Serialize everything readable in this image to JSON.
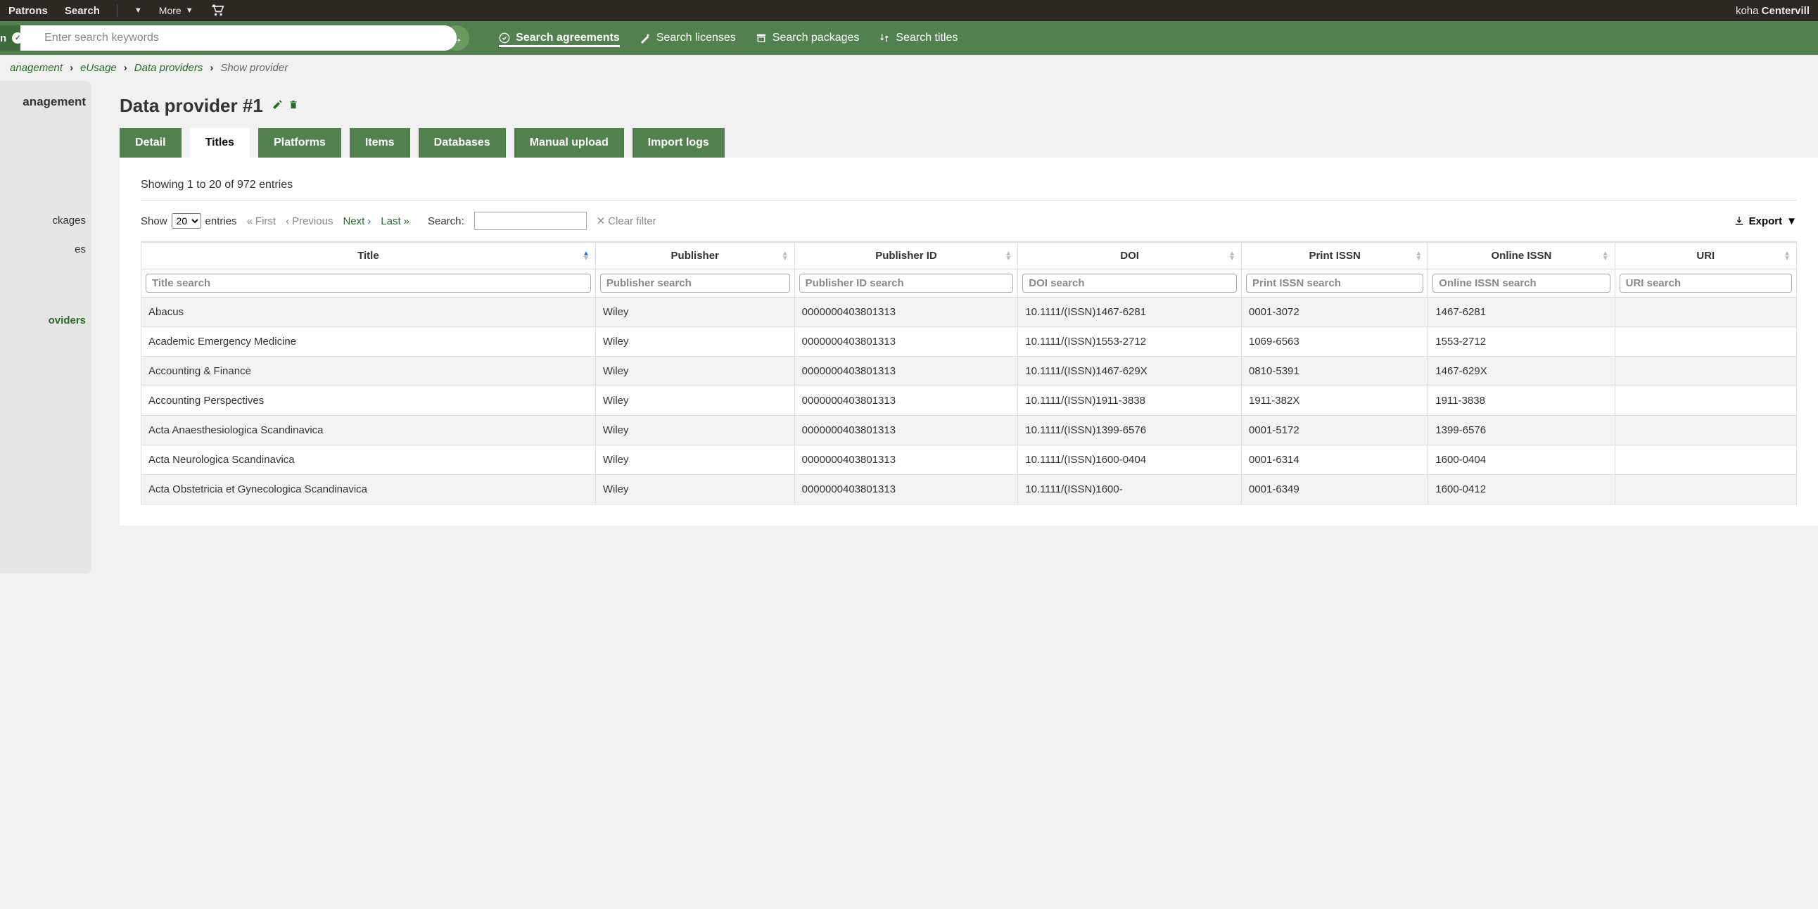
{
  "topbar": {
    "patrons": "Patrons",
    "search": "Search",
    "more": "More",
    "brand": "koha",
    "site": "Centervill"
  },
  "greenbar": {
    "pill_left": "n",
    "placeholder": "Enter search keywords",
    "links": {
      "agreements": "Search agreements",
      "licenses": "Search licenses",
      "packages": "Search packages",
      "titles": "Search titles"
    }
  },
  "breadcrumb": {
    "items": [
      "anagement",
      "eUsage",
      "Data providers",
      "Show provider"
    ]
  },
  "sidebar": {
    "heading": "anagement",
    "items": [
      "ckages",
      "es",
      "oviders"
    ]
  },
  "page": {
    "title": "Data provider #1"
  },
  "tabs": [
    "Detail",
    "Titles",
    "Platforms",
    "Items",
    "Databases",
    "Manual upload",
    "Import logs"
  ],
  "table_info": "Showing 1 to 20 of 972 entries",
  "controls": {
    "show": "Show",
    "entries": "entries",
    "entries_value": "20",
    "first": "First",
    "previous": "Previous",
    "next": "Next",
    "last": "Last",
    "search": "Search:",
    "clear": "Clear filter",
    "export": "Export"
  },
  "columns": [
    {
      "label": "Title",
      "placeholder": "Title search"
    },
    {
      "label": "Publisher",
      "placeholder": "Publisher search"
    },
    {
      "label": "Publisher ID",
      "placeholder": "Publisher ID search"
    },
    {
      "label": "DOI",
      "placeholder": "DOI search"
    },
    {
      "label": "Print ISSN",
      "placeholder": "Print ISSN search"
    },
    {
      "label": "Online ISSN",
      "placeholder": "Online ISSN search"
    },
    {
      "label": "URI",
      "placeholder": "URI search"
    }
  ],
  "rows": [
    {
      "title": "Abacus",
      "publisher": "Wiley",
      "pubid": "0000000403801313",
      "doi": "10.1111/(ISSN)1467-6281",
      "pissn": "0001-3072",
      "oissn": "1467-6281",
      "uri": ""
    },
    {
      "title": "Academic Emergency Medicine",
      "publisher": "Wiley",
      "pubid": "0000000403801313",
      "doi": "10.1111/(ISSN)1553-2712",
      "pissn": "1069-6563",
      "oissn": "1553-2712",
      "uri": ""
    },
    {
      "title": "Accounting & Finance",
      "publisher": "Wiley",
      "pubid": "0000000403801313",
      "doi": "10.1111/(ISSN)1467-629X",
      "pissn": "0810-5391",
      "oissn": "1467-629X",
      "uri": ""
    },
    {
      "title": "Accounting Perspectives",
      "publisher": "Wiley",
      "pubid": "0000000403801313",
      "doi": "10.1111/(ISSN)1911-3838",
      "pissn": "1911-382X",
      "oissn": "1911-3838",
      "uri": ""
    },
    {
      "title": "Acta Anaesthesiologica Scandinavica",
      "publisher": "Wiley",
      "pubid": "0000000403801313",
      "doi": "10.1111/(ISSN)1399-6576",
      "pissn": "0001-5172",
      "oissn": "1399-6576",
      "uri": ""
    },
    {
      "title": "Acta Neurologica Scandinavica",
      "publisher": "Wiley",
      "pubid": "0000000403801313",
      "doi": "10.1111/(ISSN)1600-0404",
      "pissn": "0001-6314",
      "oissn": "1600-0404",
      "uri": ""
    },
    {
      "title": "Acta Obstetricia et Gynecologica Scandinavica",
      "publisher": "Wiley",
      "pubid": "0000000403801313",
      "doi": "10.1111/(ISSN)1600-",
      "pissn": "0001-6349",
      "oissn": "1600-0412",
      "uri": ""
    }
  ]
}
